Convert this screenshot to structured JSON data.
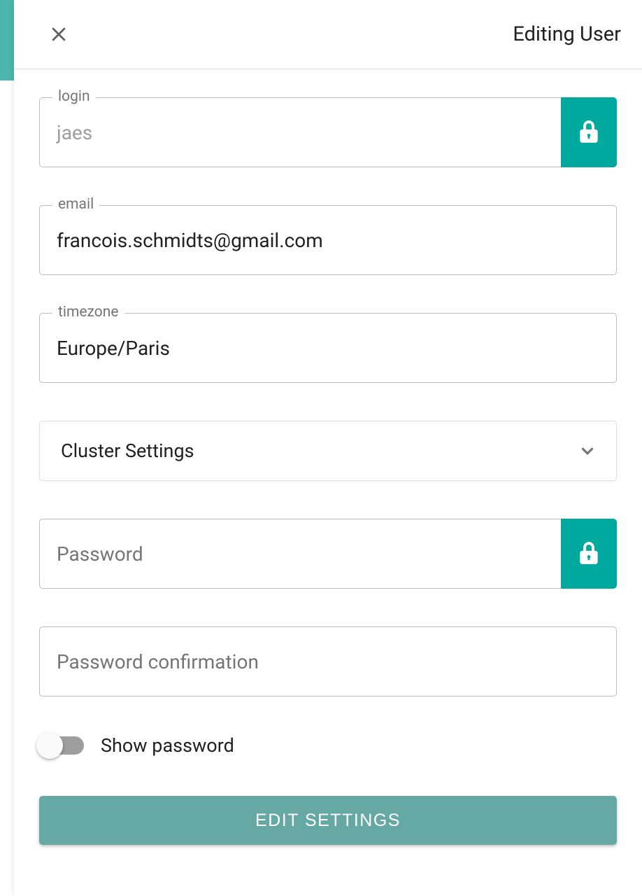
{
  "header": {
    "title": "Editing User"
  },
  "fields": {
    "login": {
      "label": "login",
      "value": "jaes"
    },
    "email": {
      "label": "email",
      "value": "francois.schmidts@gmail.com"
    },
    "timezone": {
      "label": "timezone",
      "value": "Europe/Paris"
    },
    "password": {
      "placeholder": "Password"
    },
    "password_confirm": {
      "placeholder": "Password confirmation"
    }
  },
  "accordion": {
    "cluster_settings": "Cluster Settings"
  },
  "toggles": {
    "show_password": {
      "label": "Show password",
      "checked": false
    }
  },
  "buttons": {
    "submit": "EDIT SETTINGS"
  }
}
